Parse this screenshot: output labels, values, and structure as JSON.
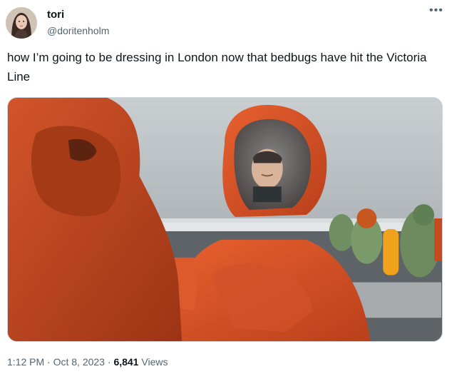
{
  "user": {
    "display_name": "tori",
    "handle": "@doritenholm"
  },
  "tweet": {
    "text": "how I’m going to be dressing in London now that bedbugs have hit the Victoria Line"
  },
  "meta": {
    "time": "1:12 PM",
    "separator": "·",
    "date": "Oct 8, 2023",
    "views_count": "6,841",
    "views_label": "Views"
  },
  "icons": {
    "more": "more-dots-icon"
  }
}
